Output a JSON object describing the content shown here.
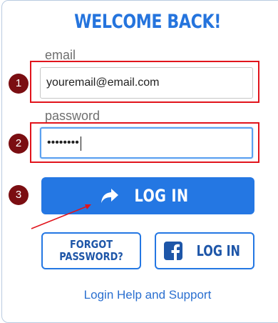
{
  "heading": "WELCOME BACK!",
  "email": {
    "label": "email",
    "value": "youremail@email.com"
  },
  "password": {
    "label": "password",
    "value": "••••••••"
  },
  "steps": [
    "1",
    "2",
    "3"
  ],
  "login_button": {
    "label": "LOG IN",
    "icon": "share-arrow-icon"
  },
  "forgot_button": {
    "line1": "FORGOT",
    "line2": "PASSWORD?"
  },
  "facebook_button": {
    "label": "LOG IN",
    "icon": "facebook-icon"
  },
  "help_link": "Login Help and Support",
  "colors": {
    "brand_blue": "#2477e3",
    "highlight_red": "#e1141c",
    "step_badge": "#7b0e12"
  }
}
